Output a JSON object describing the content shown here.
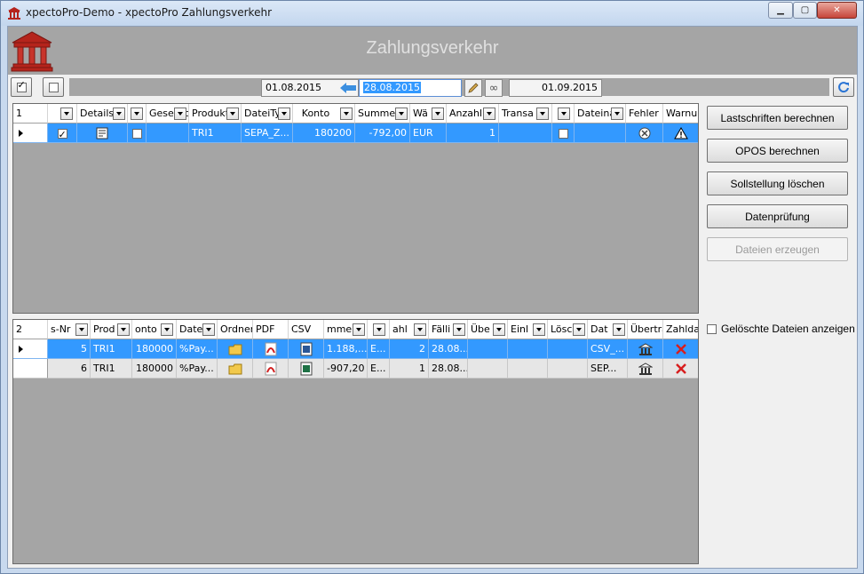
{
  "window": {
    "title": "xpectoPro-Demo - xpectoPro Zahlungsverkehr",
    "controls": {
      "minimize": "▁",
      "maximize": "▢",
      "close": "✕"
    }
  },
  "header": {
    "title": "Zahlungsverkehr"
  },
  "toolbar": {
    "date_from": "01.08.2015",
    "date_current": "28.08.2015",
    "date_to": "01.09.2015",
    "infinity_symbol": "∞"
  },
  "grid1": {
    "row_count": "1",
    "columns": [
      "",
      "Details",
      "",
      "Gesellsc",
      "Produkt",
      "DateiTy",
      "Konto",
      "Summe",
      "Wä",
      "Anzahl",
      "Transa",
      "",
      "Dateina",
      "Fehler",
      "Warnu"
    ],
    "rows": [
      {
        "checked": true,
        "details_icon": "detail-icon",
        "flag": false,
        "gesellschaft": "",
        "produkt": "TRI1",
        "dateityp": "SEPA_Z...",
        "konto": "180200",
        "summe": "-792,00",
        "waehrung": "EUR",
        "anzahl": "1",
        "transaktion": "",
        "flag2": false,
        "dateiname": "",
        "fehler_icon": "error-circle-icon",
        "warnung_icon": "warning-icon"
      }
    ]
  },
  "grid2": {
    "row_count": "2",
    "columns": [
      "s-Nr",
      "Prod",
      "onto",
      "Date",
      "Ordner",
      "PDF",
      "CSV",
      "mme",
      "",
      "ahl",
      "Fälli",
      "Übe",
      "Einl",
      "Lösc",
      "Dat",
      "Übertra",
      "Zahlda"
    ],
    "rows": [
      {
        "nr": "5",
        "produkt": "TRI1",
        "konto": "180000",
        "datei": "%Pay...",
        "summe": "1.188,...",
        "waehrung": "E...",
        "anzahl": "2",
        "faellig": "28.08...",
        "dateiname": "CSV_...",
        "csv_icon": "csv-file-icon"
      },
      {
        "nr": "6",
        "produkt": "TRI1",
        "konto": "180000",
        "datei": "%Pay...",
        "summe": "-907,20",
        "waehrung": "E...",
        "anzahl": "1",
        "faellig": "28.08...",
        "dateiname": "SEP...",
        "csv_icon": "excel-file-icon"
      }
    ]
  },
  "actions": {
    "lastschriften": "Lastschriften berechnen",
    "opos": "OPOS berechnen",
    "sollstellung": "Sollstellung löschen",
    "datenpruefung": "Datenprüfung",
    "dateien": "Dateien erzeugen",
    "show_deleted": "Gelöschte Dateien anzeigen"
  },
  "colors": {
    "selection": "#3399ff",
    "band": "#a5a5a5",
    "logo_red": "#b5241c"
  }
}
